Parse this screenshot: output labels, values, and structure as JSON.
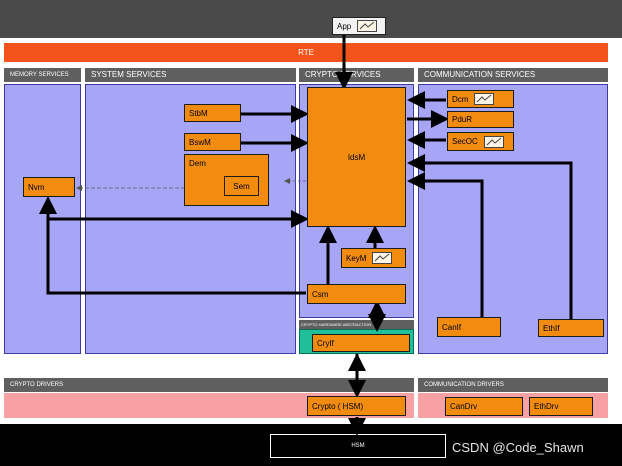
{
  "app": {
    "label": "App"
  },
  "rte": {
    "label": "RTE"
  },
  "headers": {
    "memory": "MEMORY SERVICES",
    "system": "SYSTEM SERVICES",
    "crypto": "CRYPTO SERVICES",
    "communication": "COMMUNICATION SERVICES",
    "crypto_hw_abstraction": "CRYPTO HARDWARE ABSTRACTION",
    "crypto_drivers": "CRYPTO DRIVERS",
    "communication_drivers": "COMMUNICATION DRIVERS"
  },
  "modules": {
    "nvm": "Nvm",
    "stbm": "StbM",
    "bswm": "BswM",
    "dem": "Dem",
    "sem": "Sem",
    "idsm": "IdsM",
    "keym": "KeyM",
    "csm": "Csm",
    "cryif": "CryIf",
    "dcm": "Dcm",
    "pdur": "PduR",
    "secoc": "SecOC",
    "canif": "CanIf",
    "ethif": "EthIf",
    "crypto_hsm": "Crypto ( HSM)",
    "candrv": "CanDrv",
    "ethdrv": "EthDrv",
    "hsm": "HSM"
  },
  "watermark": "CSDN @Code_Shawn",
  "colors": {
    "rte": "#f2541b",
    "module": "#f28c0f",
    "layer": "#a7a5f5",
    "driver_band": "#f8a1a5",
    "hw_abstraction": "#1fbf9a"
  }
}
